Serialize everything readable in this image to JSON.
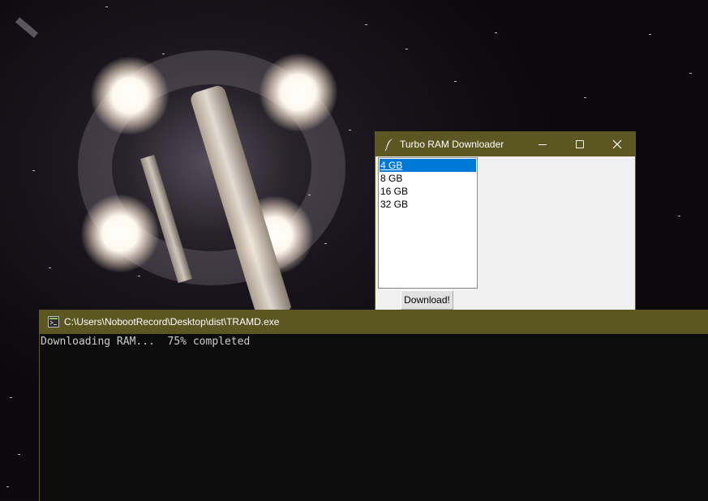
{
  "tk_window": {
    "title": "Turbo RAM Downloader",
    "listbox_options": [
      "4 GB",
      "8 GB",
      "16 GB",
      "32 GB"
    ],
    "selected_option": "4 GB",
    "download_button_label": "Download!",
    "icons": {
      "app": "feather-icon",
      "minimize": "minimize-icon",
      "maximize": "maximize-icon",
      "close": "close-icon"
    }
  },
  "console_window": {
    "title": "C:\\Users\\NobootRecord\\Desktop\\dist\\TRAMD.exe",
    "output_line": "Downloading RAM...  75% completed",
    "icon": "console-app-icon"
  },
  "colors": {
    "titlebar": "#5c5722",
    "selection": "#0078d7",
    "console_bg": "#0c0c0c",
    "console_text": "#cccccc"
  }
}
